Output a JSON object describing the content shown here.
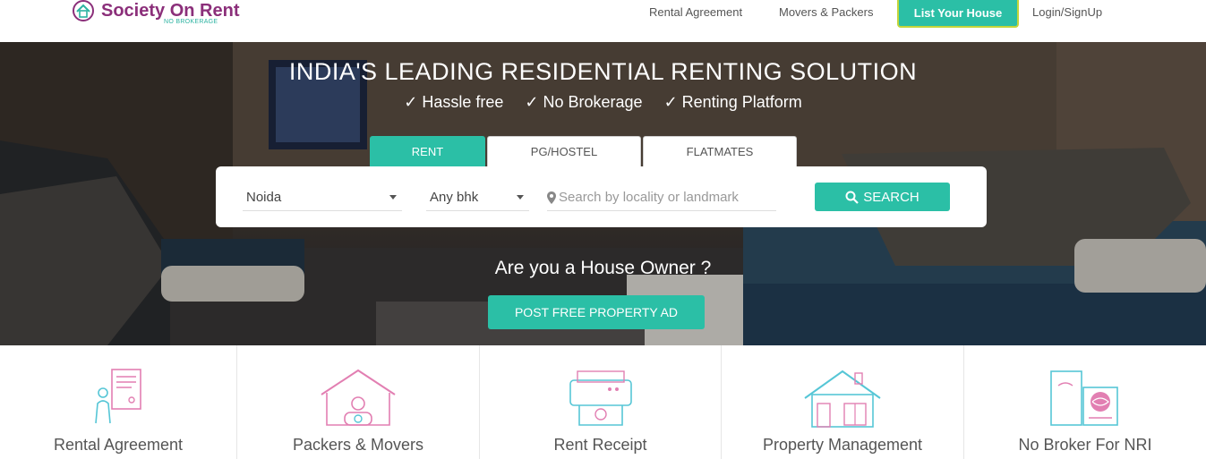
{
  "header": {
    "logo": {
      "name": "Society On Rent",
      "tagline": "NO BROKERAGE",
      "icon": "house-logo-icon"
    },
    "nav": {
      "rental_agreement": "Rental Agreement",
      "movers_packers": "Movers & Packers",
      "list_house": "List Your House",
      "login": "Login/SignUp"
    }
  },
  "hero": {
    "title": "INDIA'S LEADING RESIDENTIAL RENTING SOLUTION",
    "features": [
      "Hassle free",
      "No Brokerage",
      "Renting Platform"
    ],
    "tabs": [
      "RENT",
      "PG/HOSTEL",
      "FLATMATES"
    ],
    "active_tab": "RENT",
    "search": {
      "city": "Noida",
      "bhk": "Any bhk",
      "locality_placeholder": "Search by locality or landmark",
      "button": "SEARCH"
    },
    "owner_question": "Are you a House Owner ?",
    "post_button": "POST FREE PROPERTY AD"
  },
  "services": [
    {
      "label": "Rental Agreement",
      "icon": "rental-agreement-icon"
    },
    {
      "label": "Packers & Movers",
      "icon": "packers-movers-icon"
    },
    {
      "label": "Rent Receipt",
      "icon": "rent-receipt-icon"
    },
    {
      "label": "Property Management",
      "icon": "property-management-icon"
    },
    {
      "label": "No Broker For NRI",
      "icon": "nri-globe-icon"
    }
  ],
  "colors": {
    "brand_purple": "#8b2f7a",
    "accent_teal": "#2bbfa6",
    "highlight_border": "#c3d53a"
  }
}
